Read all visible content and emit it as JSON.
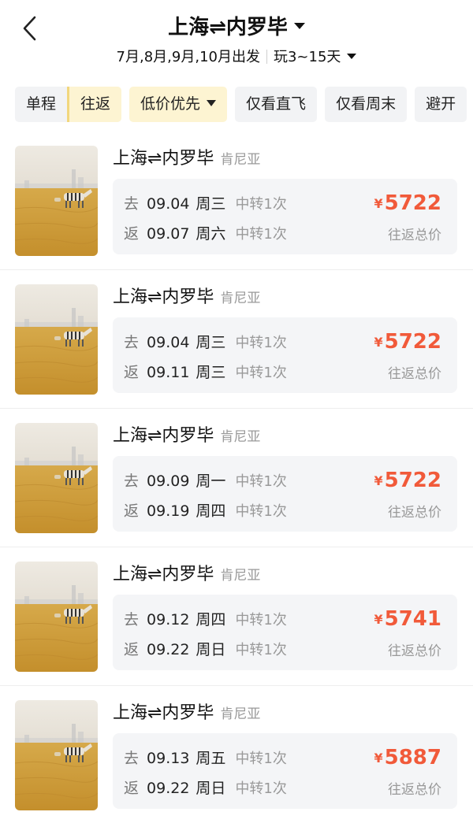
{
  "header": {
    "title": "上海⇌内罗毕",
    "depart_months": "7月,8月,9月,10月出发",
    "duration": "玩3~15天"
  },
  "filters": {
    "trip_oneway": "单程",
    "trip_roundtrip": "往返",
    "sort": "低价优先",
    "direct_only": "仅看直飞",
    "weekend_only": "仅看周末",
    "avoid": "避开"
  },
  "common": {
    "route": "上海⇌内罗毕",
    "country": "肯尼亚",
    "go_tag": "去",
    "return_tag": "返",
    "currency": "¥",
    "price_note": "往返总价"
  },
  "results": [
    {
      "go_date": "09.04",
      "go_weekday": "周三",
      "go_stops": "中转1次",
      "ret_date": "09.07",
      "ret_weekday": "周六",
      "ret_stops": "中转1次",
      "price": "5722"
    },
    {
      "go_date": "09.04",
      "go_weekday": "周三",
      "go_stops": "中转1次",
      "ret_date": "09.11",
      "ret_weekday": "周三",
      "ret_stops": "中转1次",
      "price": "5722"
    },
    {
      "go_date": "09.09",
      "go_weekday": "周一",
      "go_stops": "中转1次",
      "ret_date": "09.19",
      "ret_weekday": "周四",
      "ret_stops": "中转1次",
      "price": "5722"
    },
    {
      "go_date": "09.12",
      "go_weekday": "周四",
      "go_stops": "中转1次",
      "ret_date": "09.22",
      "ret_weekday": "周日",
      "ret_stops": "中转1次",
      "price": "5741"
    },
    {
      "go_date": "09.13",
      "go_weekday": "周五",
      "go_stops": "中转1次",
      "ret_date": "09.22",
      "ret_weekday": "周日",
      "ret_stops": "中转1次",
      "price": "5887"
    }
  ],
  "colors": {
    "price": "#f15a3a",
    "active_chip": "#fdf4d2",
    "chip_bg": "#f2f3f5",
    "detail_bg": "#f4f5f7"
  }
}
